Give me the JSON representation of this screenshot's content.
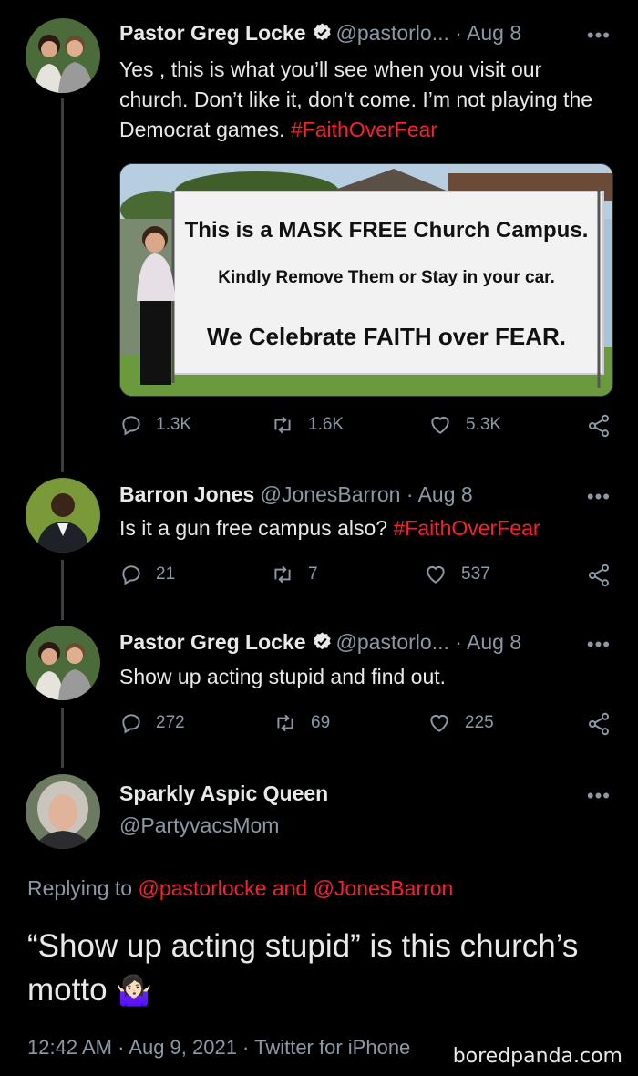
{
  "colors": {
    "background": "#000000",
    "text": "#e7e9ea",
    "muted": "#8b98a5",
    "hashtag": "#f4212e",
    "verified": "#e7e9ea"
  },
  "tweets": [
    {
      "name": "Pastor Greg Locke",
      "verified": true,
      "handle": "@pastorlo...",
      "date": "· Aug 8",
      "text": "Yes , this is what you’ll see when you visit our church. Don’t like it, don’t come. I’m not playing the Democrat games. ",
      "hashtag": "#FaithOverFear",
      "media_sign": {
        "line1": "This is a MASK FREE Church Campus.",
        "line2": "Kindly Remove Them or Stay in your car.",
        "line3": "We Celebrate FAITH over FEAR."
      },
      "replies": "1.3K",
      "retweets": "1.6K",
      "likes": "5.3K"
    },
    {
      "name": "Barron Jones",
      "verified": false,
      "handle": "@JonesBarron",
      "date": "· Aug 8",
      "text": "Is it a gun free campus also? ",
      "hashtag": "#FaithOverFear",
      "replies": "21",
      "retweets": "7",
      "likes": "537"
    },
    {
      "name": "Pastor Greg Locke",
      "verified": true,
      "handle": "@pastorlo...",
      "date": "· Aug 8",
      "text": "Show up acting stupid and find out.",
      "replies": "272",
      "retweets": "69",
      "likes": "225"
    }
  ],
  "focus": {
    "name": "Sparkly Aspic Queen",
    "handle": "@PartyvacsMom",
    "replying_prefix": "Replying to ",
    "replying_users": "@pastorlocke and @JonesBarron",
    "text": "“Show up acting stupid” is this church’s motto",
    "emoji": "🤷🏻‍♀️",
    "timestamp": "12:42 AM · Aug 9, 2021 · Twitter for iPhone"
  },
  "more_label": "•••",
  "watermark": "boredpanda.com"
}
